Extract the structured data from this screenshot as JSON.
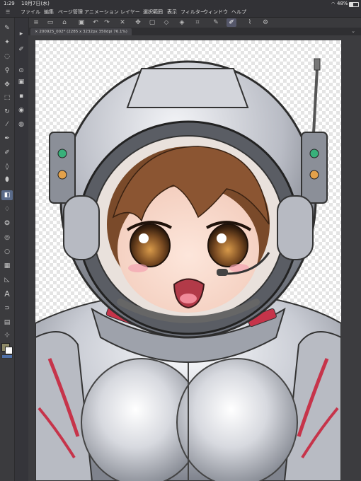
{
  "status": {
    "time": "1:29",
    "date": "10月7日(水)",
    "battery": "48%"
  },
  "menu": {
    "items": [
      "ファイル",
      "編集",
      "ページ管理",
      "アニメーション",
      "レイヤー",
      "選択範囲",
      "表示",
      "フィルター",
      "ウィンドウ",
      "ヘルプ"
    ]
  },
  "document_tab": {
    "label": "× 200925_002* (2285 x 3232px 350dpi 76.1%)"
  },
  "toolbar": {
    "icons": [
      "menu-icon",
      "new-icon",
      "open-icon",
      "save-icon",
      "undo-icon",
      "redo-icon",
      "delete-icon",
      "transform-icon",
      "select-all-icon",
      "deselect-icon",
      "fill-icon",
      "crop-icon",
      "pen-icon",
      "brush-icon",
      "eyedropper-icon",
      "settings-icon"
    ]
  },
  "tools": {
    "icons": [
      "pencil-icon",
      "wand-icon",
      "lasso-icon",
      "zoom-icon",
      "move-icon",
      "select-icon",
      "rotate-icon",
      "eyedropper-icon",
      "pen-icon",
      "brush-icon",
      "eraser-icon",
      "fill-icon",
      "gradient-icon",
      "blur-icon",
      "airbrush-icon",
      "shape-icon",
      "frame-icon",
      "ruler-icon",
      "text-icon",
      "balloon-icon",
      "line-icon",
      "figure-icon",
      "layer-icon",
      "correct-icon"
    ]
  },
  "colors": {
    "main": "#8e8a68",
    "sub": "#ffffff",
    "accent": "#5a6b8a",
    "suit_red": "#c6344a"
  }
}
